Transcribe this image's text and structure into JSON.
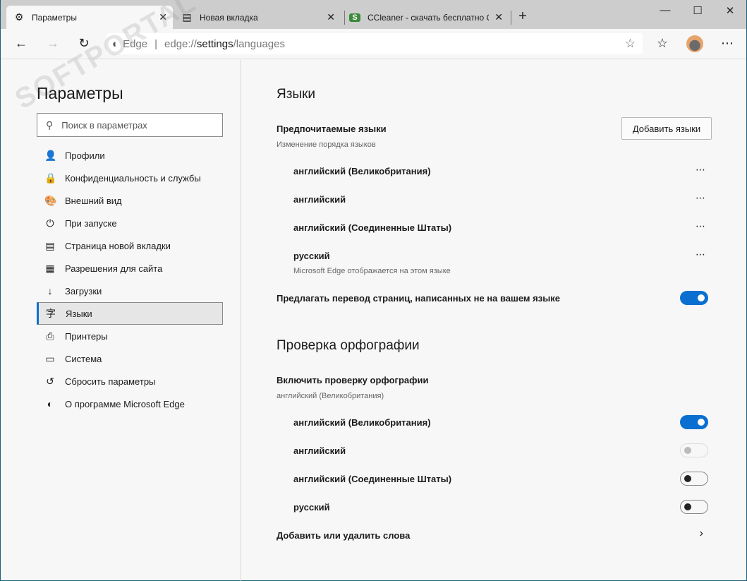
{
  "tabs": [
    {
      "label": "Параметры",
      "icon": "gear-icon"
    },
    {
      "label": "Новая вкладка",
      "icon": "new-tab-icon"
    },
    {
      "label": "CCleaner - скачать бесплатно C",
      "icon": "softportal-icon"
    }
  ],
  "toolbar": {
    "site": "Edge",
    "url_prefix": "edge://",
    "url_path": "settings",
    "url_suffix": "/languages"
  },
  "watermark": "SOFTPORTAL",
  "sidebar": {
    "title": "Параметры",
    "search_placeholder": "Поиск в параметрах",
    "items": [
      {
        "label": "Профили",
        "icon": "👤"
      },
      {
        "label": "Конфиденциальность и службы",
        "icon": "🔒"
      },
      {
        "label": "Внешний вид",
        "icon": "🎨"
      },
      {
        "label": "При запуске",
        "icon": "⏻"
      },
      {
        "label": "Страница новой вкладки",
        "icon": "▤"
      },
      {
        "label": "Разрешения для сайта",
        "icon": "▦"
      },
      {
        "label": "Загрузки",
        "icon": "↓"
      },
      {
        "label": "Языки",
        "icon": "字"
      },
      {
        "label": "Принтеры",
        "icon": "⎙"
      },
      {
        "label": "Система",
        "icon": "▭"
      },
      {
        "label": "Сбросить параметры",
        "icon": "↺"
      },
      {
        "label": "О программе Microsoft Edge",
        "icon": "◐"
      }
    ]
  },
  "main": {
    "languages_title": "Языки",
    "preferred_label": "Предпочитаемые языки",
    "preferred_sub": "Изменение порядка языков",
    "add_button": "Добавить языки",
    "languages": [
      "английский (Великобритания)",
      "английский",
      "английский (Соединенные Штаты)",
      "русский"
    ],
    "russian_note": "Microsoft Edge отображается на этом языке",
    "offer_translate": "Предлагать перевод страниц, написанных не на вашем языке",
    "offer_translate_on": true,
    "spell_title": "Проверка орфографии",
    "spell_enable": "Включить проверку орфографии",
    "spell_sub": "английский (Великобритания)",
    "spell_langs": [
      {
        "label": "английский (Великобритания)",
        "state": "on"
      },
      {
        "label": "английский",
        "state": "disabled"
      },
      {
        "label": "английский (Соединенные Штаты)",
        "state": "off"
      },
      {
        "label": "русский",
        "state": "off"
      }
    ],
    "add_remove_words": "Добавить или удалить слова"
  }
}
